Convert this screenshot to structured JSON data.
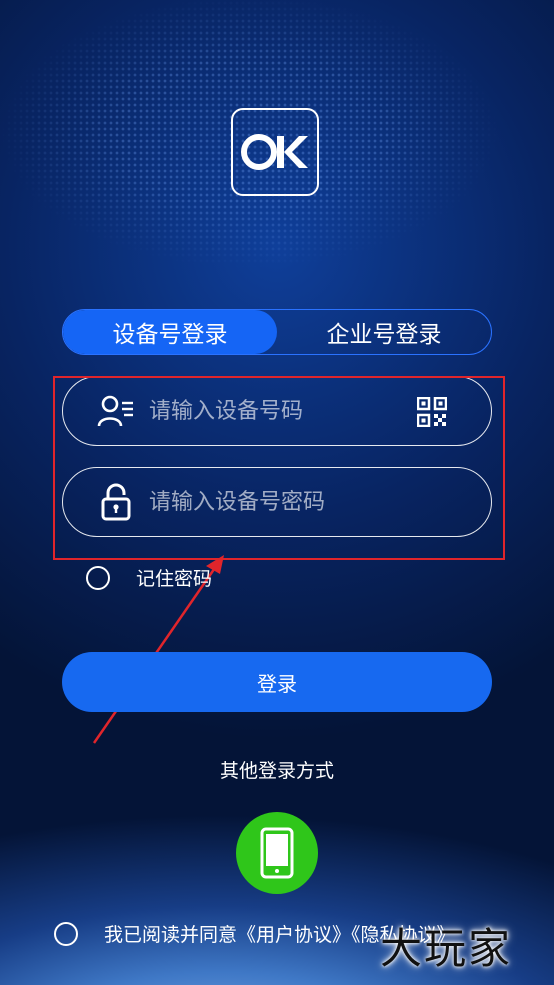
{
  "logo": {
    "text": "OK"
  },
  "tabs": [
    {
      "label": "设备号登录",
      "active": true
    },
    {
      "label": "企业号登录",
      "active": false
    }
  ],
  "fields": {
    "device_placeholder": "请输入设备号码",
    "password_placeholder": "请输入设备号密码"
  },
  "remember_label": "记住密码",
  "login_label": "登录",
  "other_login_label": "其他登录方式",
  "agreement_text": "我已阅读并同意《用户协议》《隐私协议》",
  "watermark_text": "大玩家",
  "colors": {
    "primary": "#1769f0",
    "phone_button": "#2fc61a",
    "highlight": "#e0252b"
  },
  "icons": [
    "user-list-icon",
    "qr-code-icon",
    "lock-icon",
    "phone-icon"
  ]
}
